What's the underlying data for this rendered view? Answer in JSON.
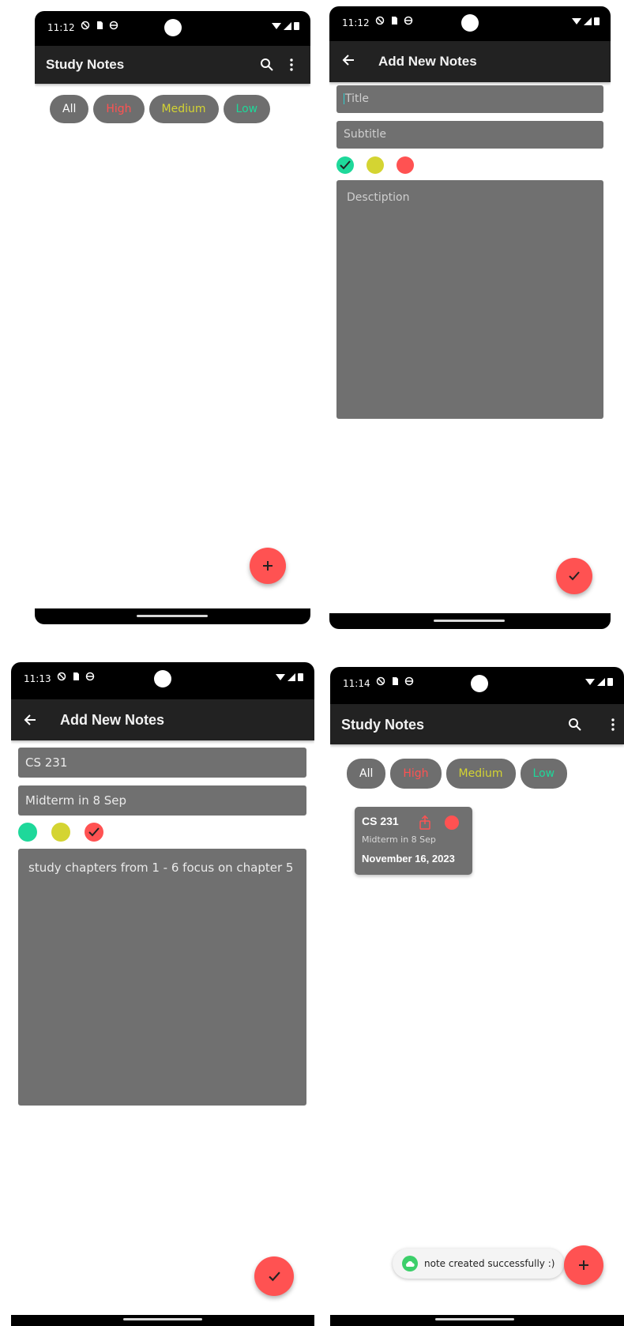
{
  "colors": {
    "high": "#ff5252",
    "medium": "#d4d432",
    "low": "#1ed89a",
    "app_bar": "#222222",
    "field": "#707070"
  },
  "screen1": {
    "status_time": "11:12",
    "title": "Study Notes",
    "filters": [
      "All",
      "High",
      "Medium",
      "Low"
    ],
    "fab_icon": "plus-icon"
  },
  "screen2": {
    "status_time": "11:12",
    "title": "Add New Notes",
    "title_placeholder": "Title",
    "subtitle_placeholder": "Subtitle",
    "description_placeholder": "Desctiption",
    "selected_priority": "green",
    "fab_icon": "check-icon"
  },
  "screen3": {
    "status_time": "11:13",
    "title": "Add New Notes",
    "title_value": "CS 231",
    "subtitle_value": "Midterm in 8 Sep",
    "description_value": "study chapters from 1 - 6 focus on chapter 5",
    "selected_priority": "red",
    "fab_icon": "check-icon"
  },
  "screen4": {
    "status_time": "11:14",
    "title": "Study Notes",
    "filters": [
      "All",
      "High",
      "Medium",
      "Low"
    ],
    "note": {
      "title": "CS 231",
      "subtitle": "Midterm in 8 Sep",
      "date": "November 16, 2023"
    },
    "toast": "note created successfully :)",
    "fab_icon": "plus-icon"
  }
}
